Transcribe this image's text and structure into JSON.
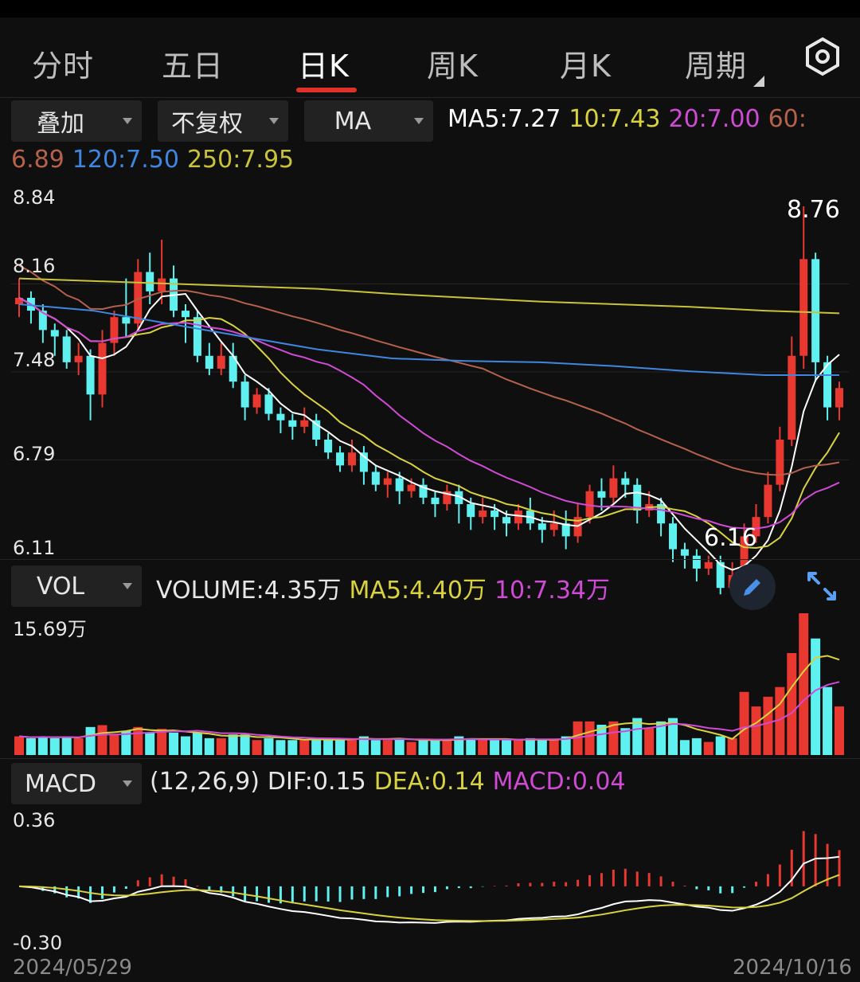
{
  "tabs": [
    {
      "label": "分时",
      "active": false
    },
    {
      "label": "五日",
      "active": false
    },
    {
      "label": "日K",
      "active": true
    },
    {
      "label": "周K",
      "active": false
    },
    {
      "label": "月K",
      "active": false
    },
    {
      "label": "周期",
      "active": false
    }
  ],
  "main_controls": {
    "overlay": "叠加",
    "adjust": "不复权",
    "indicator": "MA"
  },
  "ma_legend": {
    "ma5": "MA5:7.27",
    "ma10": "10:7.43",
    "ma20": "20:7.00",
    "ma60_key": "60:",
    "ma60_val": "6.89",
    "ma120": "120:7.50",
    "ma250": "250:7.95"
  },
  "price_axis": [
    "8.84",
    "8.16",
    "7.48",
    "6.79",
    "6.11"
  ],
  "peak_labels": {
    "high": "8.76",
    "low": "6.16"
  },
  "volume_bar": {
    "selector": "VOL",
    "volume": "VOLUME:4.35万",
    "ma5": "MA5:4.40万",
    "ma10": "10:7.34万",
    "axis_max": "15.69万"
  },
  "macd_bar": {
    "selector": "MACD",
    "params": "(12,26,9)",
    "dif": "DIF:0.15",
    "dea": "DEA:0.14",
    "macd": "MACD:0.04",
    "axis_max": "0.36",
    "axis_min": "-0.30"
  },
  "dates": {
    "start": "2024/05/29",
    "end": "2024/10/16"
  },
  "colors": {
    "up": "#e8382f",
    "down": "#5ff0f0",
    "ma5": "#ffffff",
    "ma10": "#d9d23f",
    "ma20": "#d04ad6",
    "ma60": "#b5614b",
    "ma120": "#3f86e0",
    "ma250": "#c9c23b"
  },
  "chart_data": {
    "type": "candlestick",
    "y_range": [
      6.11,
      8.84
    ],
    "candles": [
      [
        8.0,
        8.05,
        8.2,
        7.9
      ],
      [
        8.05,
        7.95,
        8.1,
        7.85
      ],
      [
        7.95,
        7.8,
        8.0,
        7.7
      ],
      [
        7.8,
        7.75,
        7.85,
        7.6
      ],
      [
        7.75,
        7.55,
        7.8,
        7.5
      ],
      [
        7.55,
        7.6,
        7.7,
        7.45
      ],
      [
        7.6,
        7.3,
        7.65,
        7.1
      ],
      [
        7.3,
        7.7,
        7.8,
        7.2
      ],
      [
        7.7,
        7.9,
        7.95,
        7.6
      ],
      [
        7.9,
        7.85,
        8.2,
        7.75
      ],
      [
        7.85,
        8.25,
        8.35,
        7.8
      ],
      [
        8.25,
        8.1,
        8.4,
        8.0
      ],
      [
        8.1,
        8.2,
        8.5,
        8.0
      ],
      [
        8.2,
        7.95,
        8.3,
        7.9
      ],
      [
        7.95,
        7.9,
        8.0,
        7.7
      ],
      [
        7.9,
        7.6,
        7.95,
        7.55
      ],
      [
        7.6,
        7.5,
        7.7,
        7.45
      ],
      [
        7.5,
        7.6,
        7.7,
        7.45
      ],
      [
        7.6,
        7.4,
        7.7,
        7.35
      ],
      [
        7.4,
        7.2,
        7.45,
        7.1
      ],
      [
        7.2,
        7.3,
        7.35,
        7.15
      ],
      [
        7.3,
        7.15,
        7.35,
        7.1
      ],
      [
        7.15,
        7.1,
        7.2,
        7.0
      ],
      [
        7.1,
        7.05,
        7.15,
        6.95
      ],
      [
        7.05,
        7.1,
        7.2,
        7.0
      ],
      [
        7.1,
        6.95,
        7.15,
        6.9
      ],
      [
        6.95,
        6.85,
        7.0,
        6.8
      ],
      [
        6.85,
        6.75,
        6.9,
        6.7
      ],
      [
        6.75,
        6.85,
        6.95,
        6.7
      ],
      [
        6.85,
        6.7,
        6.9,
        6.6
      ],
      [
        6.7,
        6.6,
        6.75,
        6.55
      ],
      [
        6.6,
        6.65,
        6.7,
        6.5
      ],
      [
        6.65,
        6.55,
        6.7,
        6.45
      ],
      [
        6.55,
        6.6,
        6.65,
        6.5
      ],
      [
        6.6,
        6.5,
        6.65,
        6.45
      ],
      [
        6.5,
        6.45,
        6.55,
        6.35
      ],
      [
        6.45,
        6.55,
        6.6,
        6.4
      ],
      [
        6.55,
        6.45,
        6.6,
        6.3
      ],
      [
        6.45,
        6.35,
        6.5,
        6.25
      ],
      [
        6.35,
        6.4,
        6.5,
        6.3
      ],
      [
        6.4,
        6.35,
        6.45,
        6.25
      ],
      [
        6.35,
        6.3,
        6.4,
        6.2
      ],
      [
        6.3,
        6.4,
        6.45,
        6.25
      ],
      [
        6.4,
        6.3,
        6.5,
        6.25
      ],
      [
        6.3,
        6.25,
        6.35,
        6.15
      ],
      [
        6.25,
        6.3,
        6.4,
        6.2
      ],
      [
        6.3,
        6.2,
        6.4,
        6.1
      ],
      [
        6.2,
        6.35,
        6.45,
        6.15
      ],
      [
        6.35,
        6.55,
        6.6,
        6.3
      ],
      [
        6.55,
        6.5,
        6.65,
        6.4
      ],
      [
        6.5,
        6.65,
        6.75,
        6.45
      ],
      [
        6.65,
        6.6,
        6.7,
        6.5
      ],
      [
        6.6,
        6.4,
        6.65,
        6.3
      ],
      [
        6.4,
        6.45,
        6.55,
        6.35
      ],
      [
        6.45,
        6.3,
        6.5,
        6.2
      ],
      [
        6.3,
        6.1,
        6.35,
        6.0
      ],
      [
        6.1,
        6.05,
        6.15,
        5.95
      ],
      [
        6.05,
        5.95,
        6.1,
        5.85
      ],
      [
        5.95,
        6.0,
        6.05,
        5.9
      ],
      [
        6.0,
        5.8,
        6.05,
        5.75
      ],
      [
        5.8,
        5.9,
        6.0,
        5.75
      ],
      [
        5.9,
        6.2,
        6.3,
        5.85
      ],
      [
        6.2,
        6.35,
        6.45,
        6.15
      ],
      [
        6.35,
        6.6,
        6.7,
        6.3
      ],
      [
        6.6,
        6.95,
        7.05,
        6.55
      ],
      [
        6.95,
        7.6,
        7.75,
        6.9
      ],
      [
        7.6,
        8.35,
        8.76,
        7.5
      ],
      [
        8.35,
        7.55,
        8.4,
        7.4
      ],
      [
        7.55,
        7.2,
        7.6,
        7.1
      ],
      [
        7.2,
        7.35,
        7.4,
        7.1
      ]
    ]
  }
}
